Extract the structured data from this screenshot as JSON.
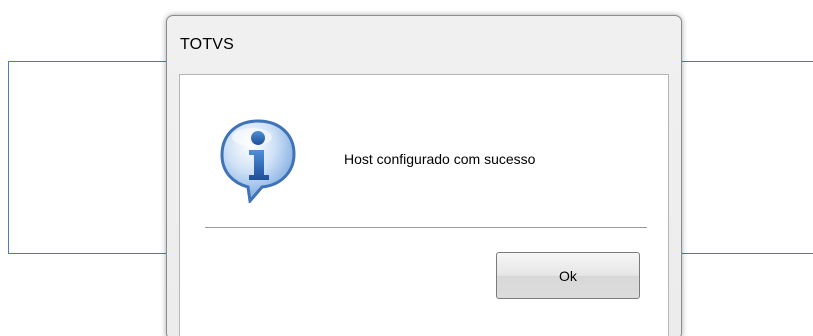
{
  "dialog": {
    "title": "TOTVS",
    "icon": "info-speech-bubble-icon",
    "message": "Host configurado com sucesso",
    "ok_label": "Ok"
  },
  "colors": {
    "panel_border": "#4f79b8",
    "icon_blue": "#3a76c6",
    "dialog_bg": "#ececec"
  }
}
